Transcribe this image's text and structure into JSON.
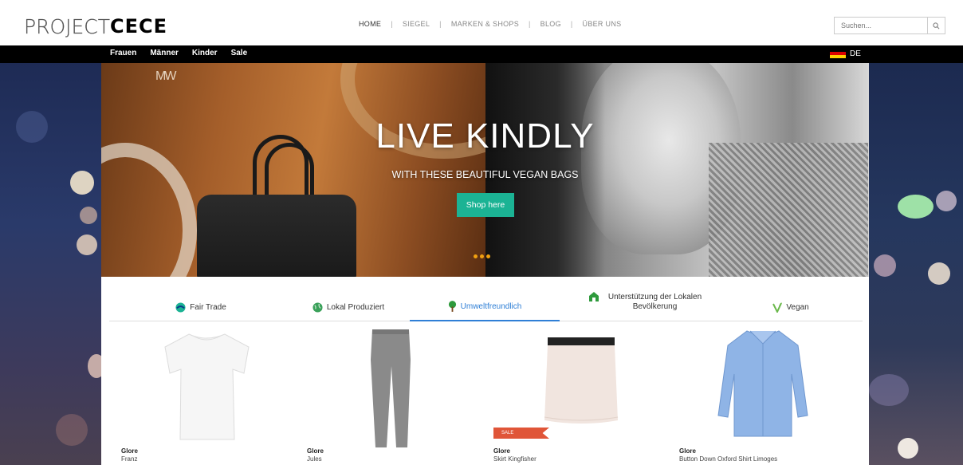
{
  "header": {
    "logo_thin": "PROJECT",
    "logo_bold": "CECE",
    "nav": [
      "HOME",
      "SIEGEL",
      "MARKEN & SHOPS",
      "BLOG",
      "ÜBER UNS"
    ],
    "nav_separator": "|",
    "search_placeholder": "Suchen..."
  },
  "catbar": {
    "categories": [
      "Frauen",
      "Männer",
      "Kinder",
      "Sale"
    ],
    "language": "DE"
  },
  "hero": {
    "brand_mark": "MW",
    "title": "LIVE KINDLY",
    "subtitle": "WITH THESE BEAUTIFUL VEGAN BAGS",
    "button": "Shop here"
  },
  "tabs": [
    {
      "label": "Fair Trade",
      "icon": "fair-trade-icon",
      "active": false
    },
    {
      "label": "Lokal Produziert",
      "icon": "globe-icon",
      "active": false
    },
    {
      "label": "Umweltfreundlich",
      "icon": "tree-icon",
      "active": true
    },
    {
      "label": "Unterstützung der Lokalen Bevölkerung",
      "icon": "community-icon",
      "active": false
    },
    {
      "label": "Vegan",
      "icon": "vegan-icon",
      "active": false
    }
  ],
  "products": [
    {
      "brand": "Glore",
      "name": "Franz",
      "sale": ""
    },
    {
      "brand": "Glore",
      "name": "Jules",
      "sale": ""
    },
    {
      "brand": "Glore",
      "name": "Skirt Kingfisher",
      "sale": "SALE"
    },
    {
      "brand": "Glore",
      "name": "Button Down Oxford Shirt Limoges",
      "sale": ""
    }
  ],
  "colors": {
    "accent": "#1bb394",
    "active_tab": "#2f7fd6",
    "sale": "#e05538",
    "carousel_dot": "#f0a010"
  }
}
